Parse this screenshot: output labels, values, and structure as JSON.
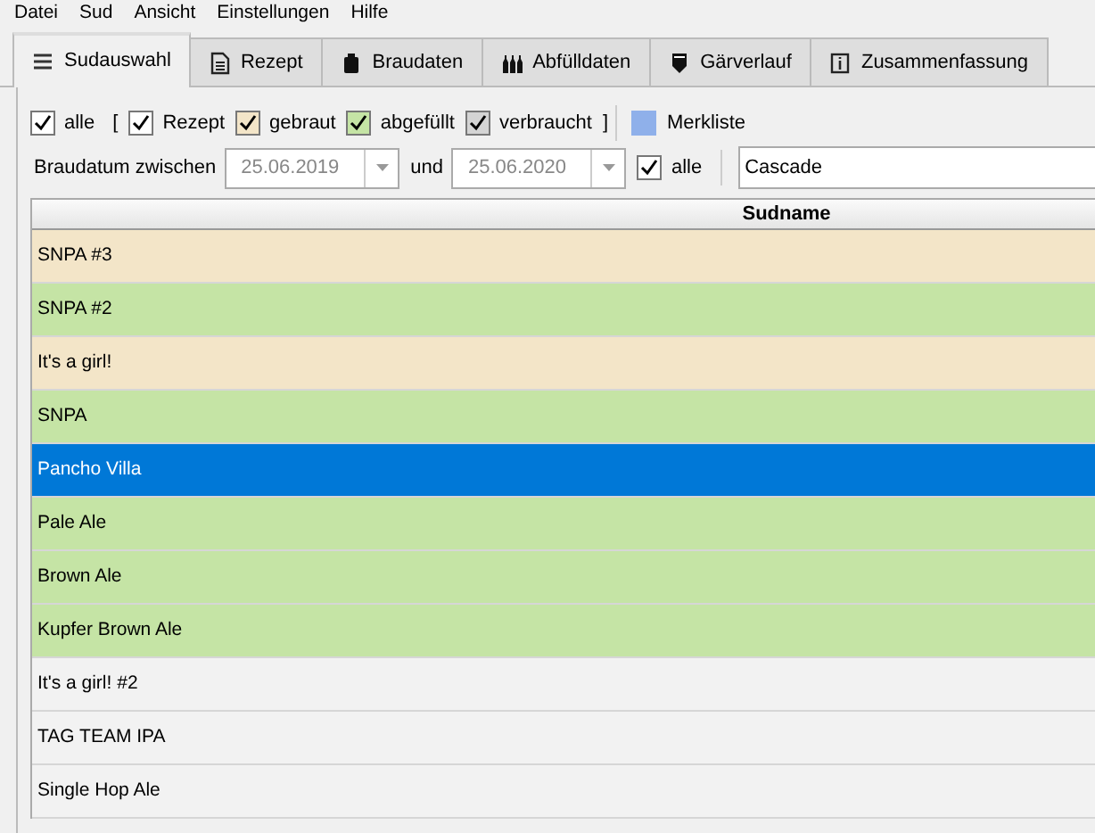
{
  "menu": [
    "Datei",
    "Sud",
    "Ansicht",
    "Einstellungen",
    "Hilfe"
  ],
  "tabs": [
    {
      "label": "Sudauswahl",
      "selected": true
    },
    {
      "label": "Rezept",
      "selected": false
    },
    {
      "label": "Braudaten",
      "selected": false
    },
    {
      "label": "Abfülldaten",
      "selected": false
    },
    {
      "label": "Gärverlauf",
      "selected": false
    },
    {
      "label": "Zusammenfassung",
      "selected": false
    }
  ],
  "filter": {
    "all": {
      "label": "alle",
      "checked": true
    },
    "open_bracket": "[",
    "close_bracket": "]",
    "states": [
      {
        "label": "Rezept",
        "checked": true,
        "color": "#ffffff"
      },
      {
        "label": "gebraut",
        "checked": true,
        "color": "#f3e5c8"
      },
      {
        "label": "abgefüllt",
        "checked": true,
        "color": "#c5e4a5"
      },
      {
        "label": "verbraucht",
        "checked": true,
        "color": "#d4d4d4"
      }
    ],
    "bookmark": {
      "label": "Merkliste",
      "color": "#8fb0ea"
    }
  },
  "date_filter": {
    "label": "Braudatum zwischen",
    "from": "25.06.2019",
    "and": "und",
    "to": "25.06.2020",
    "all": {
      "label": "alle",
      "checked": true
    }
  },
  "search": {
    "value": "Cascade"
  },
  "table": {
    "columns": [
      "Sudname"
    ],
    "rows": [
      {
        "name": "SNPA #3",
        "color": "#f3e5c8",
        "selected": false
      },
      {
        "name": "SNPA #2",
        "color": "#c5e4a5",
        "selected": false
      },
      {
        "name": "It's a girl!",
        "color": "#f3e5c8",
        "selected": false
      },
      {
        "name": "SNPA",
        "color": "#c5e4a5",
        "selected": false
      },
      {
        "name": "Pancho Villa",
        "selected": true
      },
      {
        "name": "Pale Ale",
        "color": "#c5e4a5",
        "selected": false
      },
      {
        "name": "Brown Ale",
        "color": "#c5e4a5",
        "selected": false
      },
      {
        "name": "Kupfer Brown Ale",
        "color": "#c5e4a5",
        "selected": false
      },
      {
        "name": "It's a girl! #2",
        "color": "#f2f2f2",
        "selected": false
      },
      {
        "name": "TAG TEAM IPA",
        "color": "#f2f2f2",
        "selected": false
      },
      {
        "name": "Single Hop Ale",
        "color": "#f2f2f2",
        "selected": false
      }
    ]
  }
}
